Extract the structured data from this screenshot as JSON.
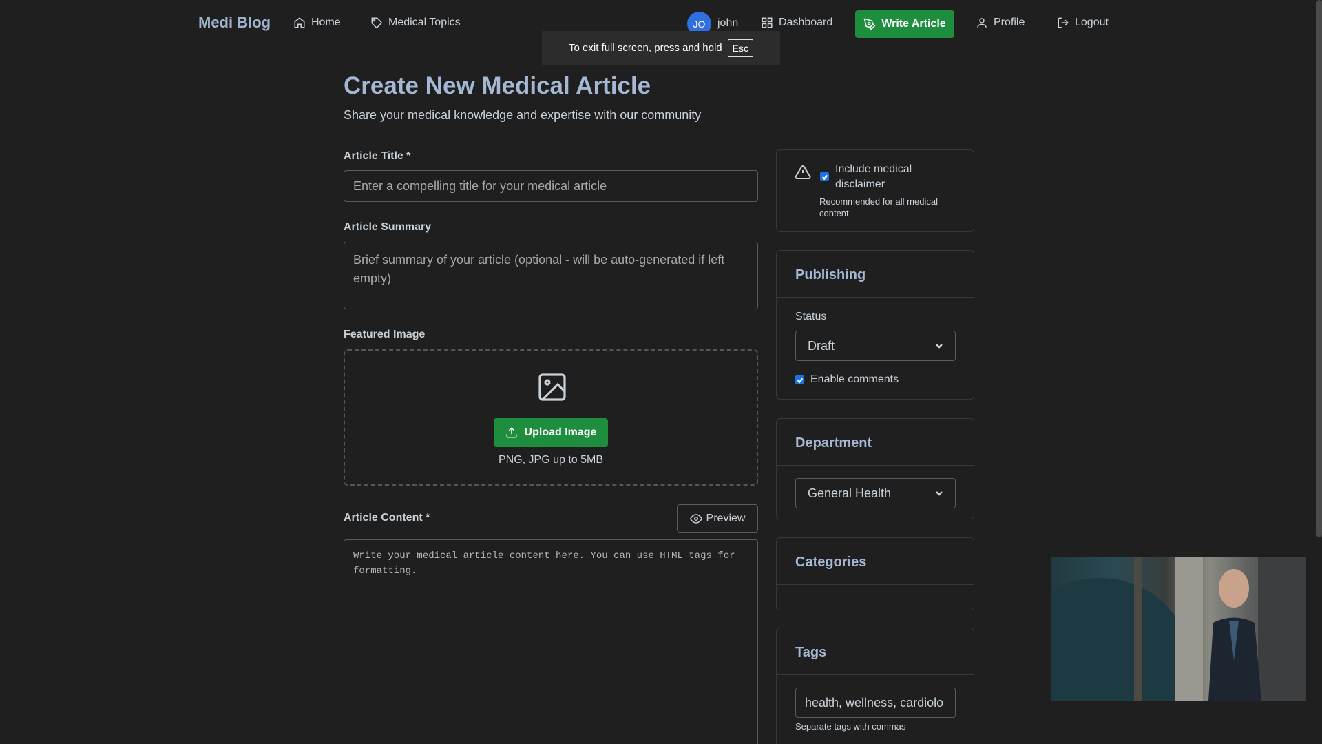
{
  "nav": {
    "brand": "Medi Blog",
    "home": "Home",
    "medical_topics": "Medical Topics",
    "avatar_initials": "JO",
    "username": "john",
    "dashboard": "Dashboard",
    "write_article": "Write Article",
    "profile": "Profile",
    "logout": "Logout"
  },
  "fullscreen_toast": {
    "text": "To exit full screen, press and hold",
    "key": "Esc"
  },
  "page": {
    "title": "Create New Medical Article",
    "subtitle": "Share your medical knowledge and expertise with our community"
  },
  "form": {
    "title_label": "Article Title *",
    "title_placeholder": "Enter a compelling title for your medical article",
    "summary_label": "Article Summary",
    "summary_placeholder": "Brief summary of your article (optional - will be auto-generated if left empty)",
    "image_label": "Featured Image",
    "upload_button": "Upload Image",
    "upload_hint": "PNG, JPG up to 5MB",
    "content_label": "Article Content *",
    "preview_button": "Preview",
    "content_placeholder": "Write your medical article content here. You can use HTML tags for formatting."
  },
  "sidebar": {
    "disclaimer": {
      "label": "Include medical disclaimer",
      "hint": "Recommended for all medical content",
      "checked": true
    },
    "publishing": {
      "title": "Publishing",
      "status_label": "Status",
      "status_value": "Draft",
      "comments_label": "Enable comments",
      "comments_checked": true
    },
    "department": {
      "title": "Department",
      "value": "General Health"
    },
    "categories": {
      "title": "Categories"
    },
    "tags": {
      "title": "Tags",
      "value": "health, wellness, cardiolo",
      "hint": "Separate tags with commas"
    }
  },
  "colors": {
    "background": "#1f1f1f",
    "accent_green": "#1e8e3e",
    "heading_blue": "#a4b8d3",
    "checkbox_blue": "#1a73e8"
  }
}
